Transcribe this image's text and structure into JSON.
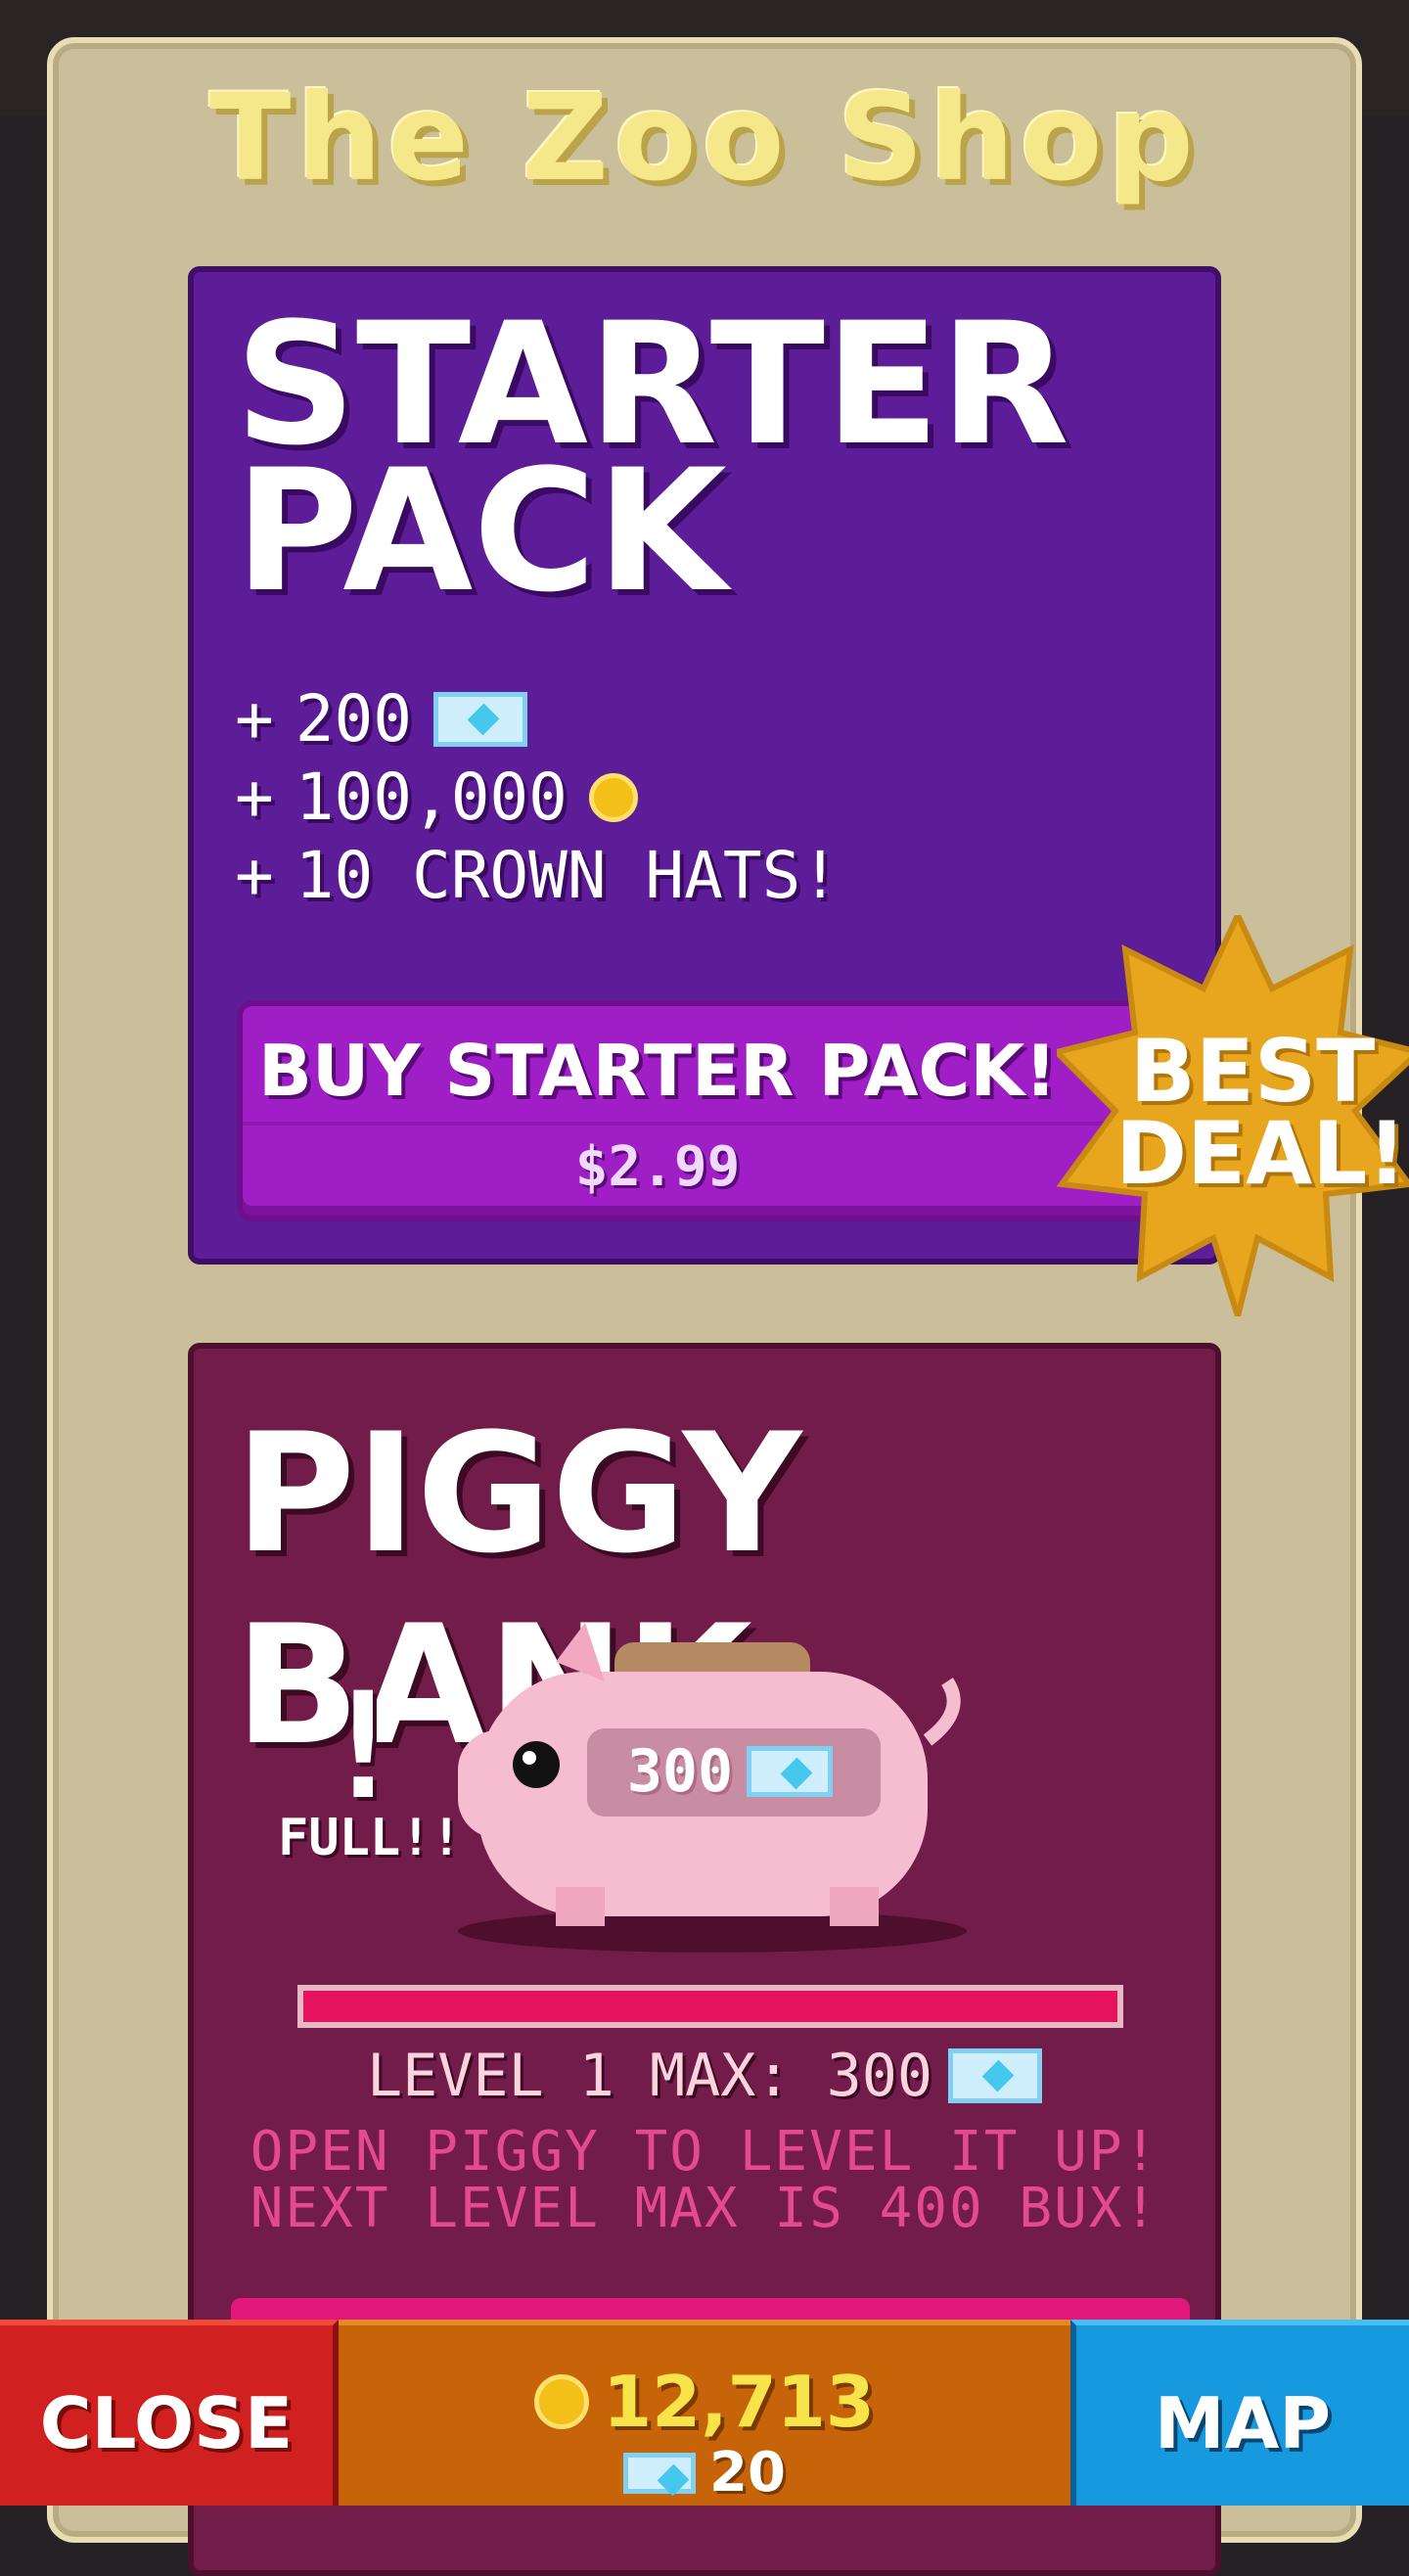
{
  "shop": {
    "title": "The Zoo Shop"
  },
  "starter_pack": {
    "title_line1": "STARTER",
    "title_line2": "PACK",
    "perks": [
      {
        "prefix": "+",
        "text": "200",
        "icon": "gem-icon"
      },
      {
        "prefix": "+",
        "text": "100,000",
        "icon": "coin-icon"
      },
      {
        "prefix": "+",
        "text": "10 CROWN HATS!",
        "icon": ""
      }
    ],
    "buy_label": "BUY STARTER PACK!",
    "price": "$2.99",
    "badge": "BEST DEAL!"
  },
  "piggy_bank": {
    "title": "PIGGY BANK",
    "full_mark": "!",
    "full_label": "FULL!!",
    "amount": "300",
    "progress": 1.0,
    "level_max_label": "LEVEL 1 MAX: 300",
    "hint_line1": "OPEN PIGGY TO LEVEL IT UP!",
    "hint_line2": "NEXT LEVEL MAX IS 400 BUX!"
  },
  "bottom_bar": {
    "close_label": "CLOSE",
    "coins": "12,713",
    "gems": "20",
    "map_label": "MAP"
  },
  "colors": {
    "starter_bg": "#5e1d98",
    "piggy_bg": "#721c4a",
    "close": "#d0201f",
    "map": "#1699df",
    "currency": "#c7640a",
    "badge": "#e8a51e"
  }
}
